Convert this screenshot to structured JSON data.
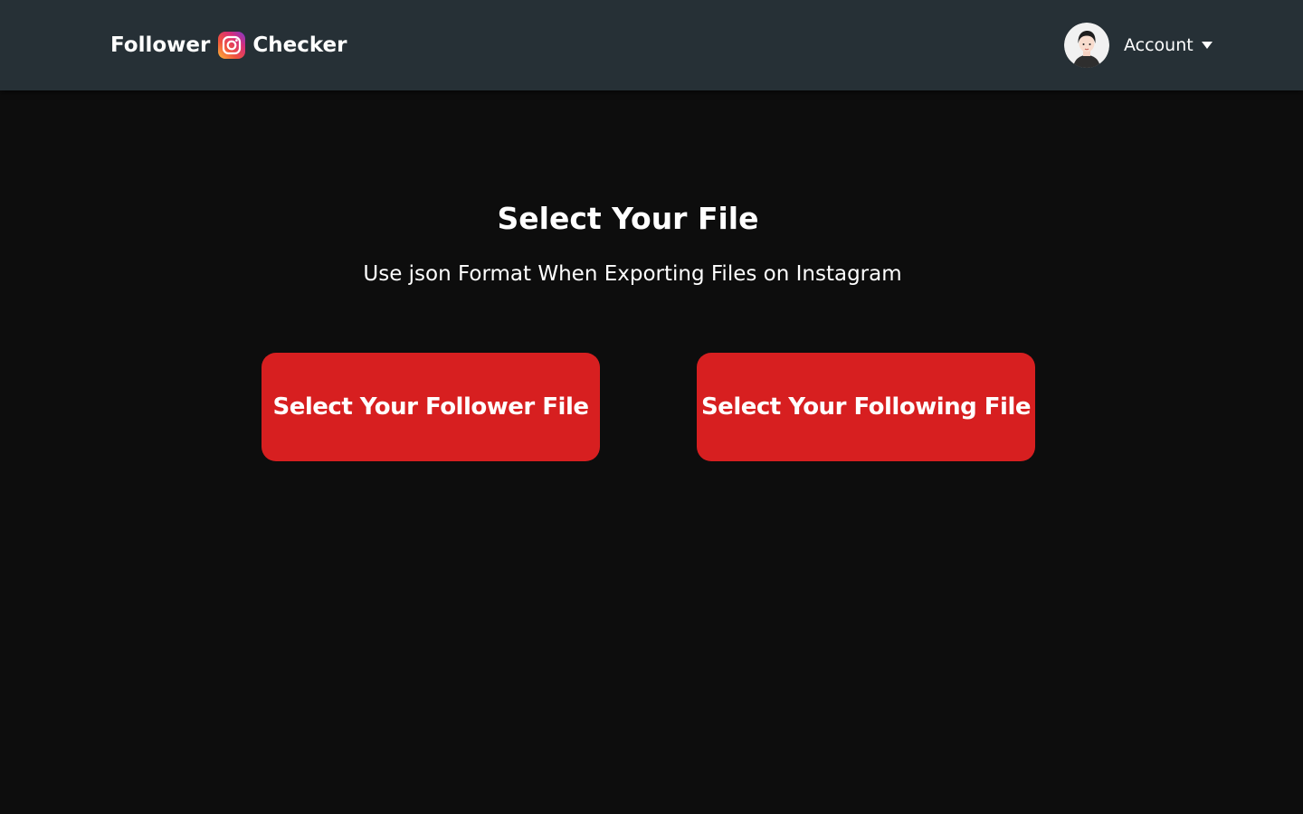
{
  "header": {
    "brand_left": "Follower",
    "brand_right": "Checker",
    "brand_icon": "instagram-icon",
    "account_label": "Account",
    "account_caret": "chevron-down-icon"
  },
  "main": {
    "title": "Select Your File",
    "subtitle": "Use json Format When Exporting Files on Instagram",
    "follower_button": "Select Your Follower File",
    "following_button": "Select Your Following File"
  },
  "colors": {
    "navbar": "#263036",
    "background": "#0d0d0d",
    "button": "#d71f20",
    "text": "#ffffff"
  }
}
